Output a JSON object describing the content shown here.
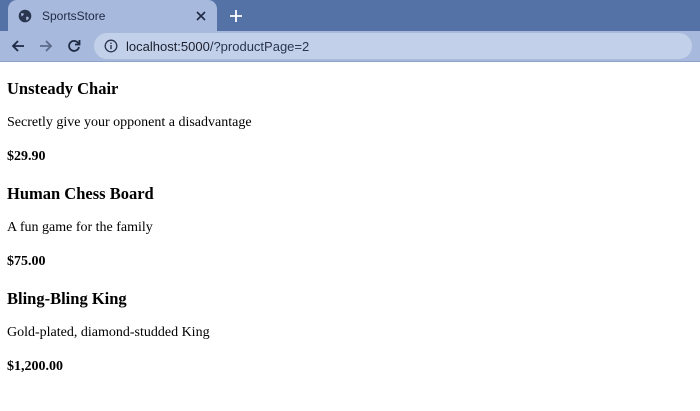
{
  "browser": {
    "tab_title": "SportsStore",
    "url_host": "localhost:5000",
    "url_path": "/?productPage=2"
  },
  "products": [
    {
      "name": "Unsteady Chair",
      "description": "Secretly give your opponent a disadvantage",
      "price": "$29.90"
    },
    {
      "name": "Human Chess Board",
      "description": "A fun game for the family",
      "price": "$75.00"
    },
    {
      "name": "Bling-Bling King",
      "description": "Gold-plated, diamond-studded King",
      "price": "$1,200.00"
    }
  ]
}
